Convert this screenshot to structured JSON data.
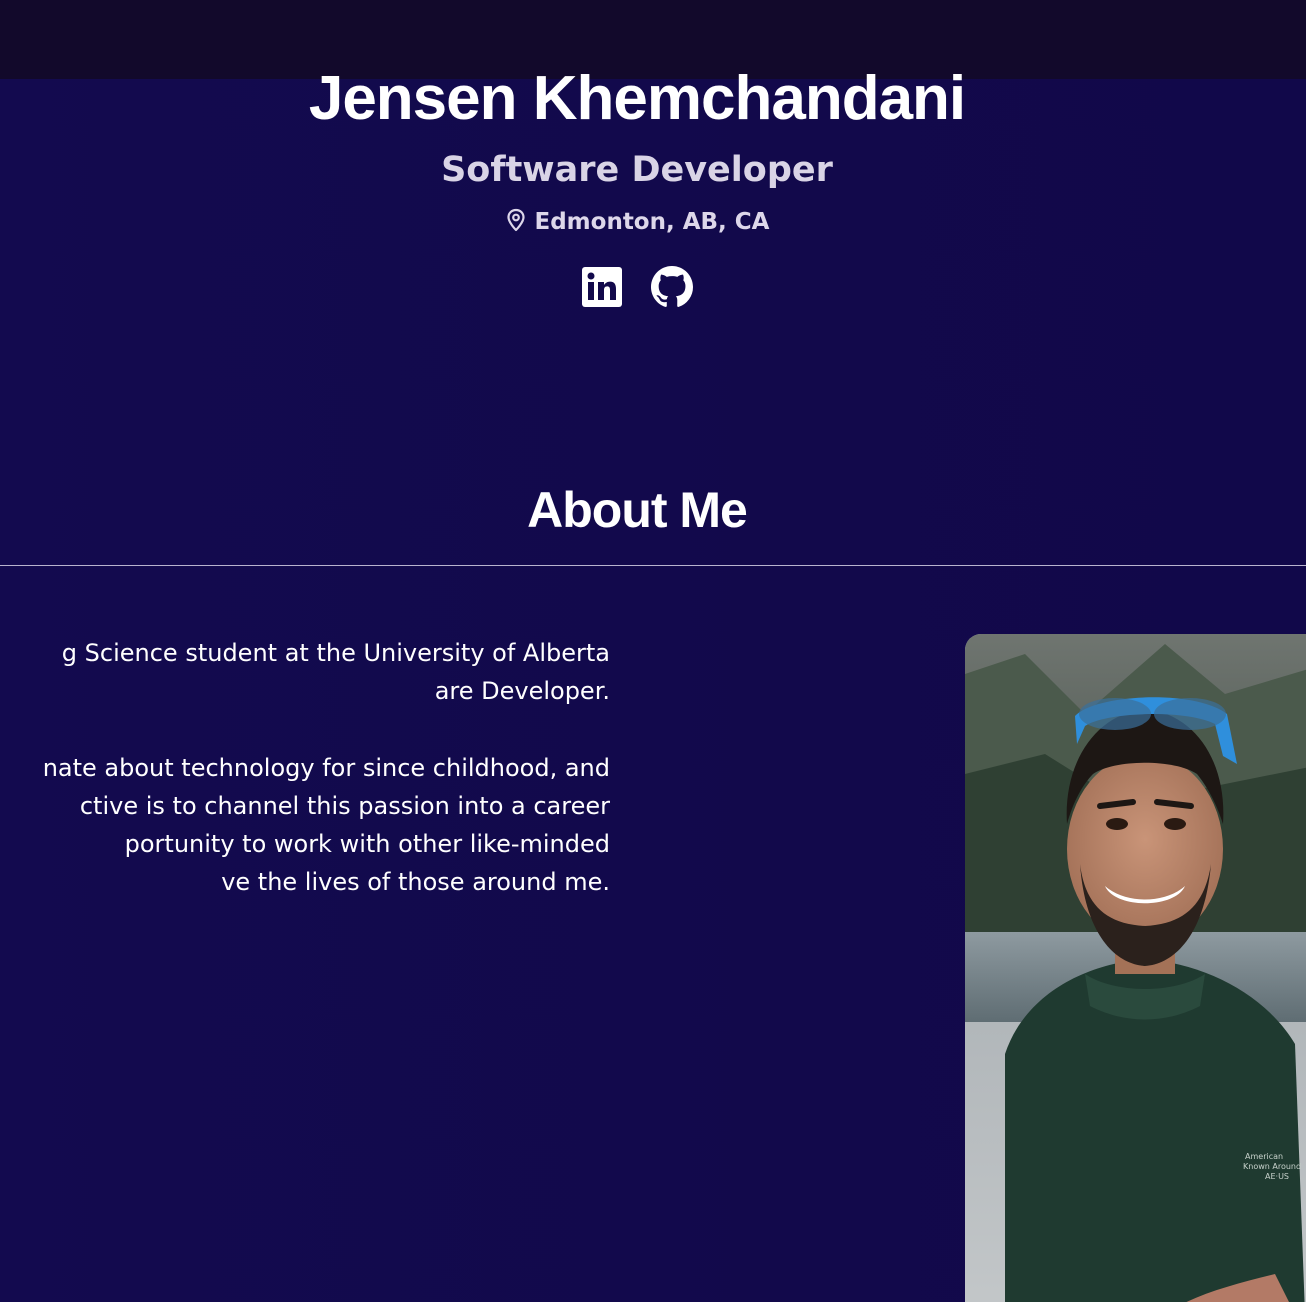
{
  "header": {
    "name": "Jensen Khemchandani",
    "role": "Software Developer",
    "location": "Edmonton, AB, CA"
  },
  "social": [
    {
      "label": "LinkedIn",
      "icon": "linkedin-icon"
    },
    {
      "label": "GitHub",
      "icon": "github-icon"
    }
  ],
  "about": {
    "title": "About Me",
    "paragraph_1_lines": [
      "g Science student at the University of Alberta",
      "are Developer."
    ],
    "paragraph_2_lines": [
      "nate about technology for since childhood, and",
      "ctive is to channel this passion into a career",
      "portunity to work with other like-minded",
      "ve the lives of those around me."
    ],
    "photo_icon": "profile-photo"
  },
  "colors": {
    "background": "#12094b",
    "top_bar": "#12092b",
    "text": "#ffffff",
    "subtext": "#d9d4e6",
    "divider": "#b9b4cf"
  }
}
